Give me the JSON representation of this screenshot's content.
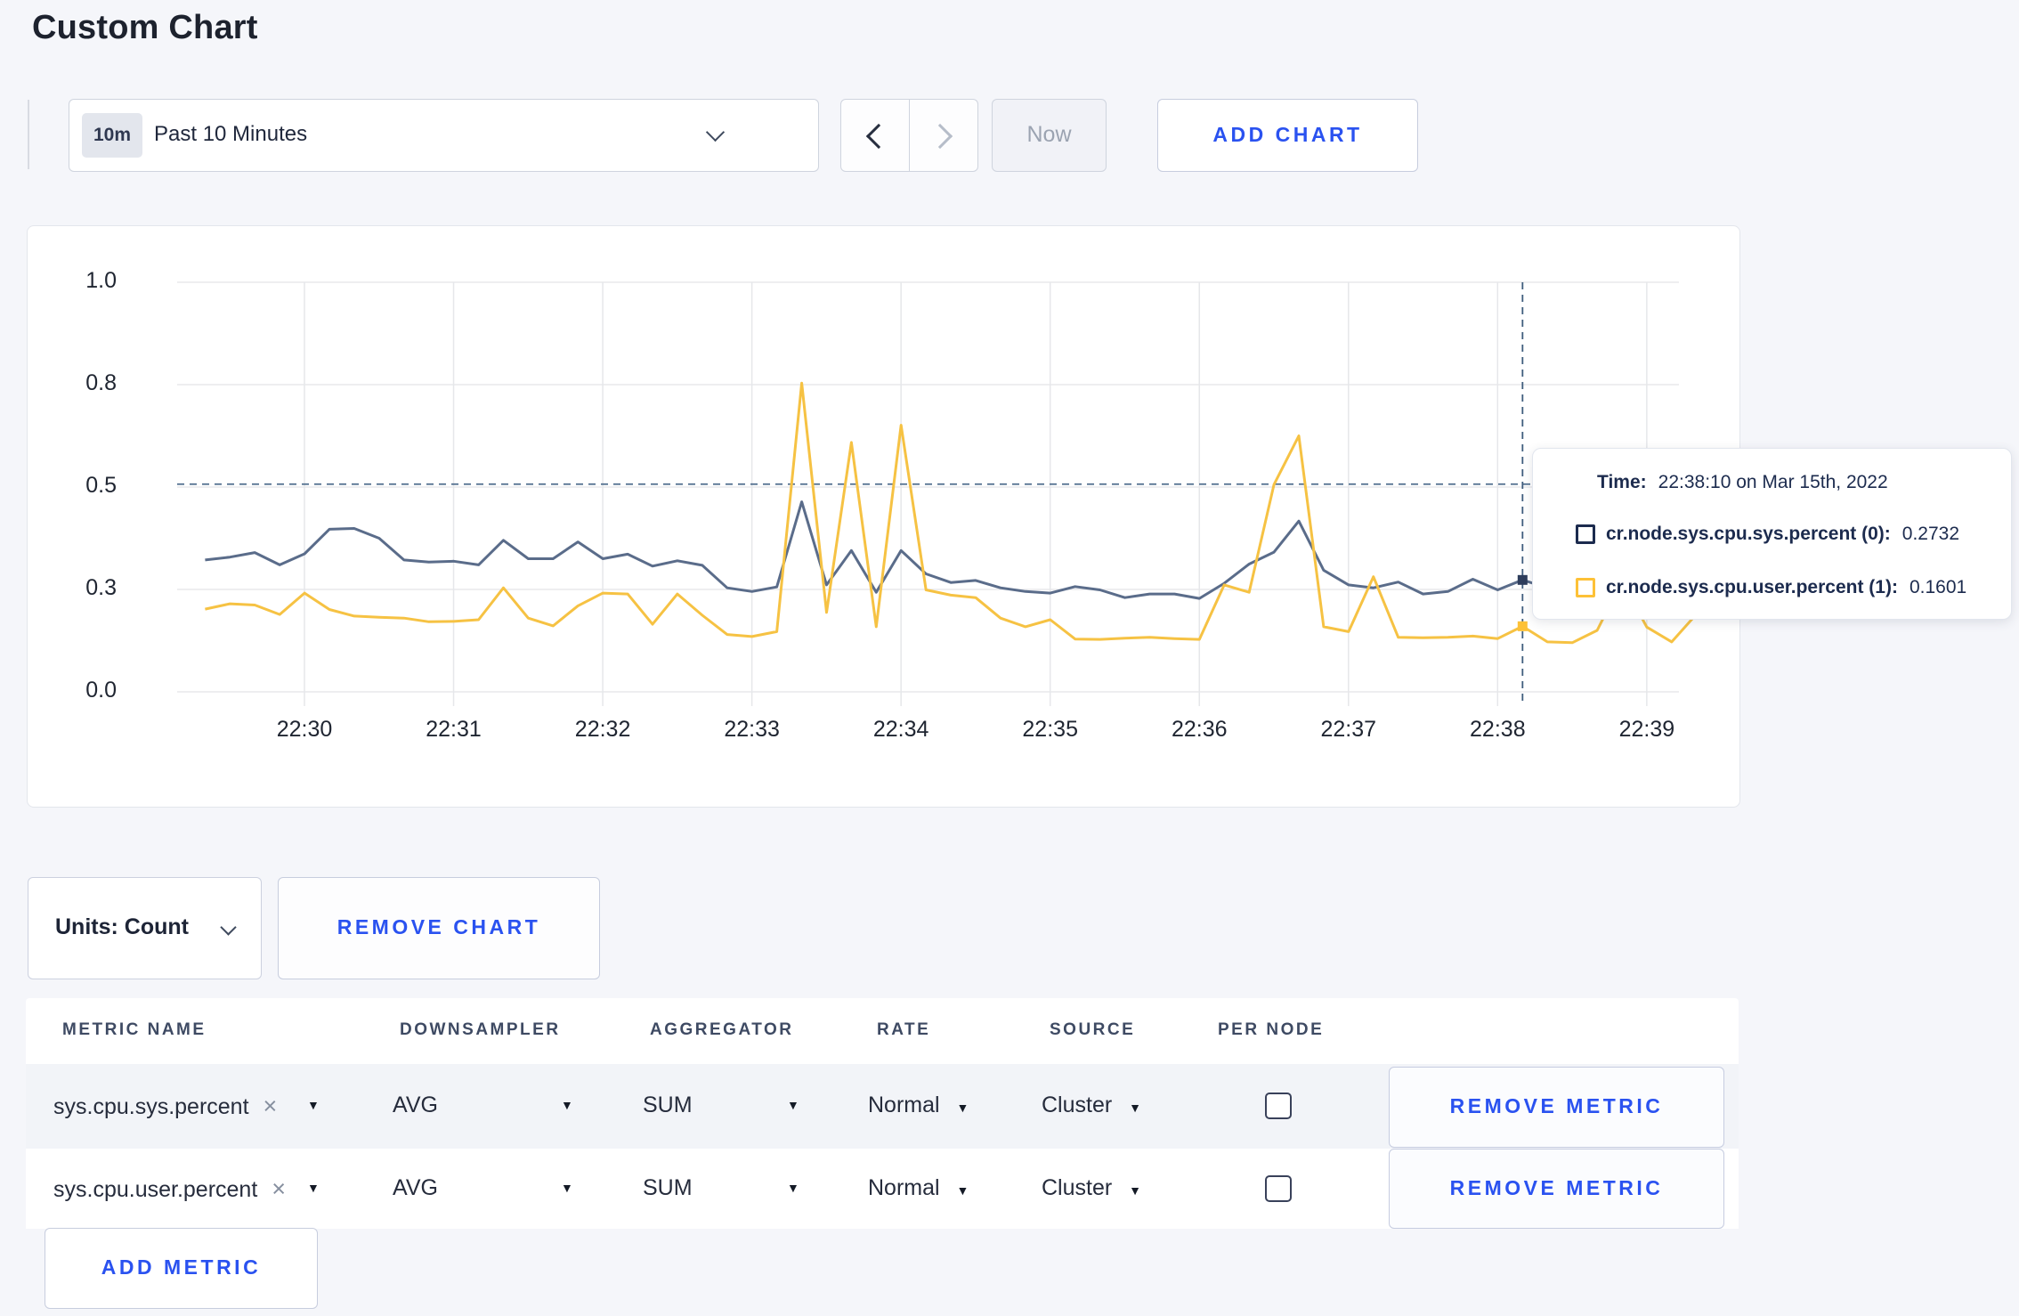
{
  "page": {
    "title": "Custom Chart"
  },
  "toolbar": {
    "range_badge": "10m",
    "range_label": "Past 10 Minutes",
    "now_label": "Now",
    "add_chart_label": "ADD CHART"
  },
  "tooltip": {
    "time_label": "Time:",
    "time_value": "22:38:10 on Mar 15th, 2022",
    "series": [
      {
        "label": "cr.node.sys.cpu.sys.percent (0):",
        "value": "0.2732",
        "swatch_color": "#1c2b4e"
      },
      {
        "label": "cr.node.sys.cpu.user.percent (1):",
        "value": "0.1601",
        "swatch_color": "#fdc137"
      }
    ]
  },
  "chart_footer": {
    "units_label": "Units: Count",
    "remove_chart_label": "REMOVE CHART"
  },
  "metrics_table": {
    "headers": [
      "METRIC NAME",
      "DOWNSAMPLER",
      "AGGREGATOR",
      "RATE",
      "SOURCE",
      "PER NODE"
    ],
    "remove_tag_icon": "×",
    "caret_icon": "▼",
    "rows": [
      {
        "metric": "sys.cpu.sys.percent",
        "downsampler": "AVG",
        "aggregator": "SUM",
        "rate": "Normal",
        "source": "Cluster",
        "per_node_checked": false,
        "remove_label": "REMOVE METRIC"
      },
      {
        "metric": "sys.cpu.user.percent",
        "downsampler": "AVG",
        "aggregator": "SUM",
        "rate": "Normal",
        "source": "Cluster",
        "per_node_checked": false,
        "remove_label": "REMOVE METRIC"
      }
    ],
    "add_metric_label": "ADD METRIC"
  },
  "chart_data": {
    "type": "line",
    "title": "",
    "grid": true,
    "ylim": [
      0,
      1
    ],
    "y_tick_values": [
      0,
      0.25,
      0.5,
      0.75,
      1.0
    ],
    "y_tick_labels": [
      "0.0",
      "0.3",
      "0.5",
      "0.8",
      "1.0"
    ],
    "x_labels": [
      "22:30",
      "22:31",
      "22:32",
      "22:33",
      "22:34",
      "22:35",
      "22:36",
      "22:37",
      "22:38",
      "22:39"
    ],
    "times": [
      "22:29:20",
      "22:29:30",
      "22:29:40",
      "22:29:50",
      "22:30:00",
      "22:30:10",
      "22:30:20",
      "22:30:30",
      "22:30:40",
      "22:30:50",
      "22:31:00",
      "22:31:10",
      "22:31:20",
      "22:31:30",
      "22:31:40",
      "22:31:50",
      "22:32:00",
      "22:32:10",
      "22:32:20",
      "22:32:30",
      "22:32:40",
      "22:32:50",
      "22:33:00",
      "22:33:10",
      "22:33:20",
      "22:33:30",
      "22:33:40",
      "22:33:50",
      "22:34:00",
      "22:34:10",
      "22:34:20",
      "22:34:30",
      "22:34:40",
      "22:34:50",
      "22:35:00",
      "22:35:10",
      "22:35:20",
      "22:35:30",
      "22:35:40",
      "22:35:50",
      "22:36:00",
      "22:36:10",
      "22:36:20",
      "22:36:30",
      "22:36:40",
      "22:36:50",
      "22:37:00",
      "22:37:10",
      "22:37:20",
      "22:37:30",
      "22:37:40",
      "22:37:50",
      "22:38:00",
      "22:38:10",
      "22:38:20",
      "22:38:30",
      "22:38:40",
      "22:38:50",
      "22:39:00",
      "22:39:10",
      "22:39:20"
    ],
    "series": [
      {
        "name": "cr.node.sys.cpu.sys.percent",
        "color": "#5a6c8a",
        "dot_color": "#2e3d5c",
        "values": [
          0.322,
          0.329,
          0.34,
          0.31,
          0.337,
          0.397,
          0.399,
          0.375,
          0.322,
          0.317,
          0.319,
          0.31,
          0.37,
          0.325,
          0.325,
          0.366,
          0.325,
          0.336,
          0.307,
          0.32,
          0.309,
          0.254,
          0.245,
          0.256,
          0.464,
          0.261,
          0.345,
          0.243,
          0.345,
          0.288,
          0.267,
          0.272,
          0.254,
          0.245,
          0.241,
          0.257,
          0.249,
          0.23,
          0.239,
          0.239,
          0.228,
          0.265,
          0.312,
          0.341,
          0.417,
          0.297,
          0.261,
          0.254,
          0.268,
          0.239,
          0.245,
          0.275,
          0.249,
          0.2732,
          0.254,
          0.248,
          0.252,
          0.26,
          0.255,
          0.248,
          0.252
        ]
      },
      {
        "name": "cr.node.sys.cpu.user.percent",
        "color": "#f6c243",
        "dot_color": "#fdc137",
        "values": [
          0.202,
          0.215,
          0.212,
          0.189,
          0.241,
          0.201,
          0.185,
          0.182,
          0.18,
          0.171,
          0.172,
          0.176,
          0.254,
          0.18,
          0.161,
          0.21,
          0.241,
          0.239,
          0.165,
          0.239,
          0.187,
          0.14,
          0.135,
          0.147,
          0.754,
          0.194,
          0.609,
          0.159,
          0.651,
          0.249,
          0.236,
          0.23,
          0.18,
          0.159,
          0.176,
          0.129,
          0.128,
          0.131,
          0.133,
          0.13,
          0.128,
          0.261,
          0.243,
          0.506,
          0.625,
          0.159,
          0.147,
          0.281,
          0.133,
          0.132,
          0.133,
          0.136,
          0.13,
          0.1601,
          0.122,
          0.12,
          0.15,
          0.27,
          0.158,
          0.122,
          0.19
        ]
      }
    ],
    "crosshair": {
      "time": "22:38:10",
      "index": 53,
      "hline_value": 0.507,
      "sys_value": 0.2732,
      "user_value": 0.1601
    }
  }
}
